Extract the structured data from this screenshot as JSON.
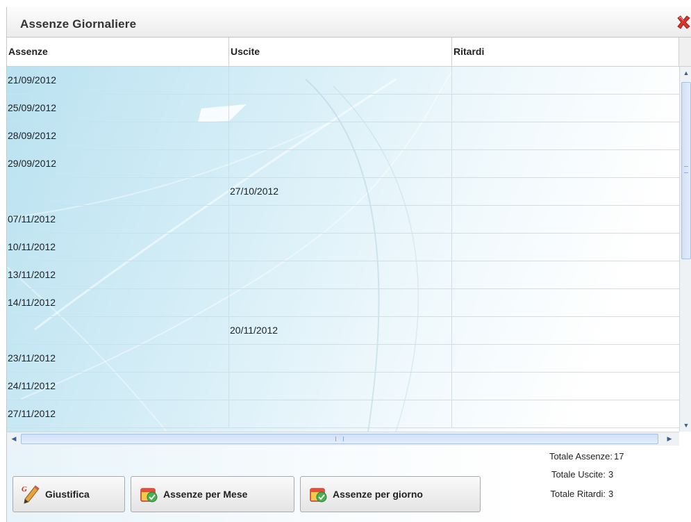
{
  "window": {
    "title": "Assenze Giornaliere"
  },
  "icons": {
    "close": "close-x-icon",
    "giustifica": "pencil-g-icon",
    "calendar": "calendar-icon"
  },
  "colors": {
    "row_gradient_start": "#b9e1f0",
    "close_red": "#d9342b",
    "scroll_blue": "#cfe0f7"
  },
  "grid": {
    "columns": [
      "Assenze",
      "Uscite",
      "Ritardi"
    ],
    "rows": [
      [
        "21/09/2012",
        "",
        ""
      ],
      [
        "25/09/2012",
        "",
        ""
      ],
      [
        "28/09/2012",
        "",
        ""
      ],
      [
        "29/09/2012",
        "",
        ""
      ],
      [
        "",
        "27/10/2012",
        ""
      ],
      [
        "07/11/2012",
        "",
        ""
      ],
      [
        "10/11/2012",
        "",
        ""
      ],
      [
        "13/11/2012",
        "",
        ""
      ],
      [
        "14/11/2012",
        "",
        ""
      ],
      [
        "",
        "20/11/2012",
        ""
      ],
      [
        "23/11/2012",
        "",
        ""
      ],
      [
        "24/11/2012",
        "",
        ""
      ],
      [
        "27/11/2012",
        "",
        ""
      ]
    ]
  },
  "buttons": {
    "giustifica": "Giustifica",
    "per_mese": "Assenze per Mese",
    "per_giorno": "Assenze per giorno"
  },
  "totals": {
    "assenze_label": "Totale Assenze:",
    "assenze_value": "17",
    "uscite_label": "Totale Uscite:",
    "uscite_value": "3",
    "ritardi_label": "Totale Ritardi:",
    "ritardi_value": "3"
  }
}
